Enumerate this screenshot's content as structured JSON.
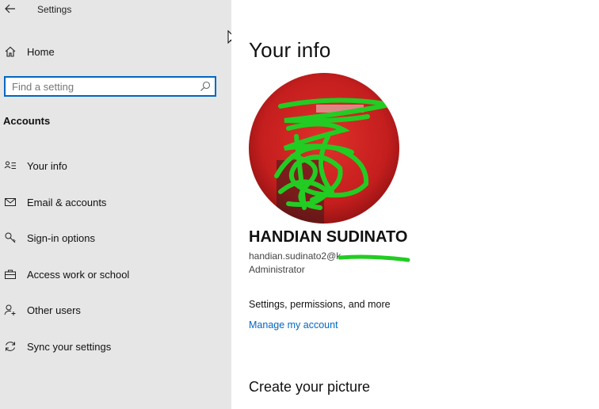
{
  "window": {
    "title": "Settings"
  },
  "sidebar": {
    "home_label": "Home",
    "search": {
      "placeholder": "Find a setting",
      "value": ""
    },
    "section_header": "Accounts",
    "items": [
      {
        "label": "Your info",
        "icon": "person-card-icon"
      },
      {
        "label": "Email & accounts",
        "icon": "mail-icon"
      },
      {
        "label": "Sign-in options",
        "icon": "key-icon"
      },
      {
        "label": "Access work or school",
        "icon": "briefcase-icon"
      },
      {
        "label": "Other users",
        "icon": "add-person-icon"
      },
      {
        "label": "Sync your settings",
        "icon": "sync-icon"
      }
    ]
  },
  "main": {
    "title": "Your info",
    "user": {
      "name": "HANDIAN SUDINATO",
      "email": "handian.sudinato2@k",
      "role": "Administrator"
    },
    "settings_text": "Settings, permissions, and more",
    "manage_link": "Manage my account",
    "picture_section_title": "Create your picture"
  },
  "colors": {
    "sidebar_bg": "#e6e6e6",
    "accent": "#0067c0",
    "redaction": "#22cc22",
    "avatar_bg": "#c41e1e"
  }
}
